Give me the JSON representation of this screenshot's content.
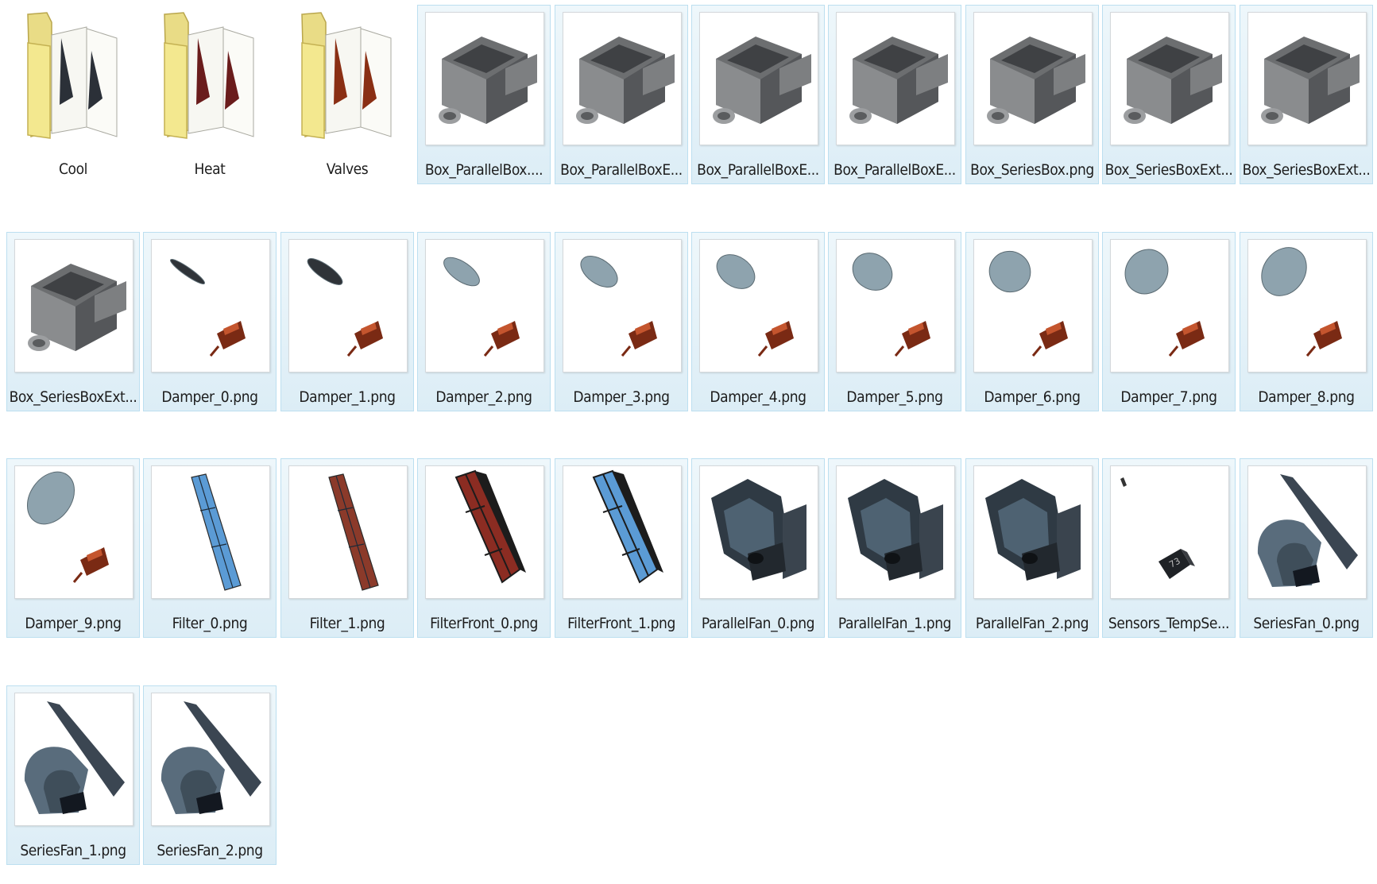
{
  "explorer": {
    "items": [
      {
        "name": "Cool",
        "kind": "folder",
        "icon": "folder-icon",
        "accent": "#2b3038"
      },
      {
        "name": "Heat",
        "kind": "folder",
        "icon": "folder-icon",
        "accent": "#6a1c1c"
      },
      {
        "name": "Valves",
        "kind": "folder",
        "icon": "folder-icon",
        "accent": "#8a2f14"
      },
      {
        "name": "Box_ParallelBox....",
        "kind": "file",
        "icon": "vav-box-icon"
      },
      {
        "name": "Box_ParallelBoxE...",
        "kind": "file",
        "icon": "vav-box-icon"
      },
      {
        "name": "Box_ParallelBoxE...",
        "kind": "file",
        "icon": "vav-box-icon"
      },
      {
        "name": "Box_ParallelBoxE...",
        "kind": "file",
        "icon": "vav-box-icon"
      },
      {
        "name": "Box_SeriesBox.png",
        "kind": "file",
        "icon": "vav-box-icon"
      },
      {
        "name": "Box_SeriesBoxExt...",
        "kind": "file",
        "icon": "vav-box-icon"
      },
      {
        "name": "Box_SeriesBoxExt...",
        "kind": "file",
        "icon": "vav-box-icon"
      },
      {
        "name": "Box_SeriesBoxExt...",
        "kind": "file",
        "icon": "vav-box-icon"
      },
      {
        "name": "Damper_0.png",
        "kind": "file",
        "icon": "damper-icon",
        "level": 0
      },
      {
        "name": "Damper_1.png",
        "kind": "file",
        "icon": "damper-icon",
        "level": 1
      },
      {
        "name": "Damper_2.png",
        "kind": "file",
        "icon": "damper-icon",
        "level": 2
      },
      {
        "name": "Damper_3.png",
        "kind": "file",
        "icon": "damper-icon",
        "level": 3
      },
      {
        "name": "Damper_4.png",
        "kind": "file",
        "icon": "damper-icon",
        "level": 4
      },
      {
        "name": "Damper_5.png",
        "kind": "file",
        "icon": "damper-icon",
        "level": 5
      },
      {
        "name": "Damper_6.png",
        "kind": "file",
        "icon": "damper-icon",
        "level": 6
      },
      {
        "name": "Damper_7.png",
        "kind": "file",
        "icon": "damper-icon",
        "level": 7
      },
      {
        "name": "Damper_8.png",
        "kind": "file",
        "icon": "damper-icon",
        "level": 8
      },
      {
        "name": "Damper_9.png",
        "kind": "file",
        "icon": "damper-icon",
        "level": 9
      },
      {
        "name": "Filter_0.png",
        "kind": "file",
        "icon": "filter-icon",
        "color": "#5b9bd5"
      },
      {
        "name": "Filter_1.png",
        "kind": "file",
        "icon": "filter-icon",
        "color": "#8b3a2a"
      },
      {
        "name": "FilterFront_0.png",
        "kind": "file",
        "icon": "filter-front-icon",
        "color": "#8b2c22"
      },
      {
        "name": "FilterFront_1.png",
        "kind": "file",
        "icon": "filter-front-icon",
        "color": "#5b9bd5"
      },
      {
        "name": "ParallelFan_0.png",
        "kind": "file",
        "icon": "parallel-fan-icon"
      },
      {
        "name": "ParallelFan_1.png",
        "kind": "file",
        "icon": "parallel-fan-icon"
      },
      {
        "name": "ParallelFan_2.png",
        "kind": "file",
        "icon": "parallel-fan-icon"
      },
      {
        "name": "Sensors_TempSe...",
        "kind": "file",
        "icon": "temp-sensor-icon"
      },
      {
        "name": "SeriesFan_0.png",
        "kind": "file",
        "icon": "series-fan-icon"
      },
      {
        "name": "SeriesFan_1.png",
        "kind": "file",
        "icon": "series-fan-icon"
      },
      {
        "name": "SeriesFan_2.png",
        "kind": "file",
        "icon": "series-fan-icon"
      }
    ]
  }
}
